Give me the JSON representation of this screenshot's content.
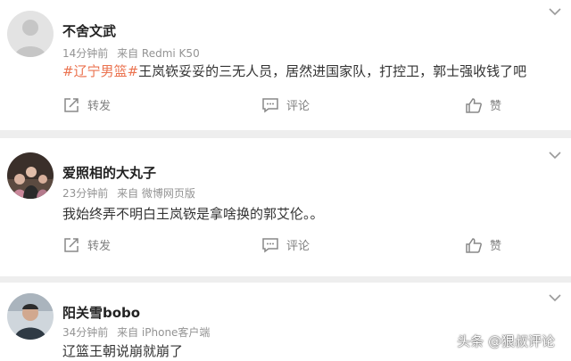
{
  "colors": {
    "hashtag": "#eb7350",
    "separator": "#eeeeee",
    "meta_text": "#939393",
    "action_text": "#808080"
  },
  "posts": [
    {
      "username": "不舍文武",
      "time": "14分钟前",
      "source": "来自 Redmi K50",
      "hashtag": "#辽宁男篮#",
      "text": "王岚嵚妥妥的三无人员，居然进国家队，打控卫，郭士强收钱了吧",
      "actions": {
        "repost": "转发",
        "comment": "评论",
        "like": "赞"
      }
    },
    {
      "username": "爱照相的大丸子",
      "time": "23分钟前",
      "source": "来自 微博网页版",
      "text": "我始终弄不明白王岚嵚是拿啥换的郭艾伦。。",
      "actions": {
        "repost": "转发",
        "comment": "评论",
        "like": "赞"
      }
    },
    {
      "username": "阳关雪bobo",
      "time": "34分钟前",
      "source": "来自 iPhone客户端",
      "text": "辽篮王朝说崩就崩了"
    }
  ],
  "watermark": "头条 @狠叔评论"
}
